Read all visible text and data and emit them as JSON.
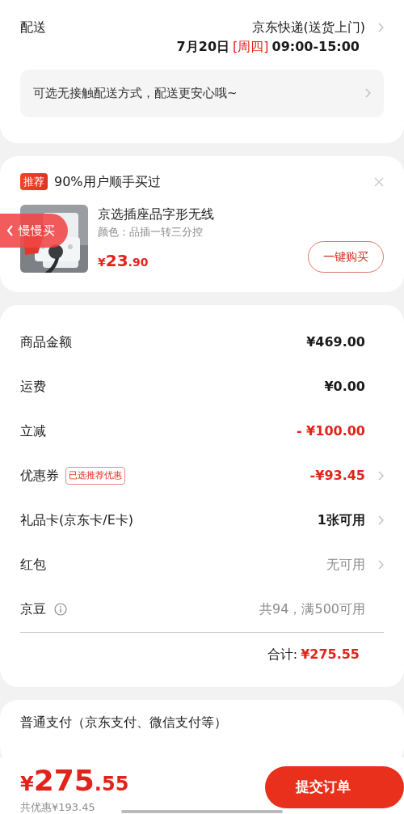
{
  "delivery": {
    "label": "配送",
    "carrier": "京东快递(送货上门)",
    "date": "7月20日",
    "weekday": "[周四]",
    "time": "09:00-15:00",
    "notice": "可选无接触配送方式，配送更安心哦~"
  },
  "recommend": {
    "tag": "推荐",
    "title": "90%用户顺手买过",
    "product": {
      "name": "京选插座品字形无线",
      "spec": "颜色：品插一转三分控",
      "price": {
        "symbol": "¥",
        "integer": "23",
        "decimal": ".90"
      },
      "button": "一键购买"
    }
  },
  "side_tab": {
    "label": "慢慢买"
  },
  "summary": {
    "rows": [
      {
        "label": "商品金额",
        "value": "¥469.00",
        "kind": "plain",
        "arrow": false
      },
      {
        "label": "运费",
        "value": "¥0.00",
        "kind": "plain",
        "arrow": false
      },
      {
        "label": "立减",
        "value": "- ¥100.00",
        "kind": "discount",
        "arrow": false
      },
      {
        "label": "优惠券",
        "tag": "已选推荐优惠",
        "value": "-¥93.45",
        "kind": "discount",
        "arrow": true
      },
      {
        "label": "礼品卡(京东卡/E卡)",
        "value": "1张可用",
        "kind": "plain",
        "arrow": true
      },
      {
        "label": "红包",
        "value": "无可用",
        "kind": "muted",
        "arrow": true
      },
      {
        "label": "京豆",
        "info": true,
        "value": "共94，满500可用",
        "kind": "muted",
        "arrow": false
      }
    ],
    "total_label": "合计:",
    "total_value": "¥275.55"
  },
  "payment": {
    "title": "普通支付（京东支付、微信支付等）"
  },
  "bottom_bar": {
    "price": {
      "symbol": "¥",
      "integer": "275",
      "decimal": ".55"
    },
    "saved": "共优惠¥193.45",
    "submit": "提交订单"
  }
}
